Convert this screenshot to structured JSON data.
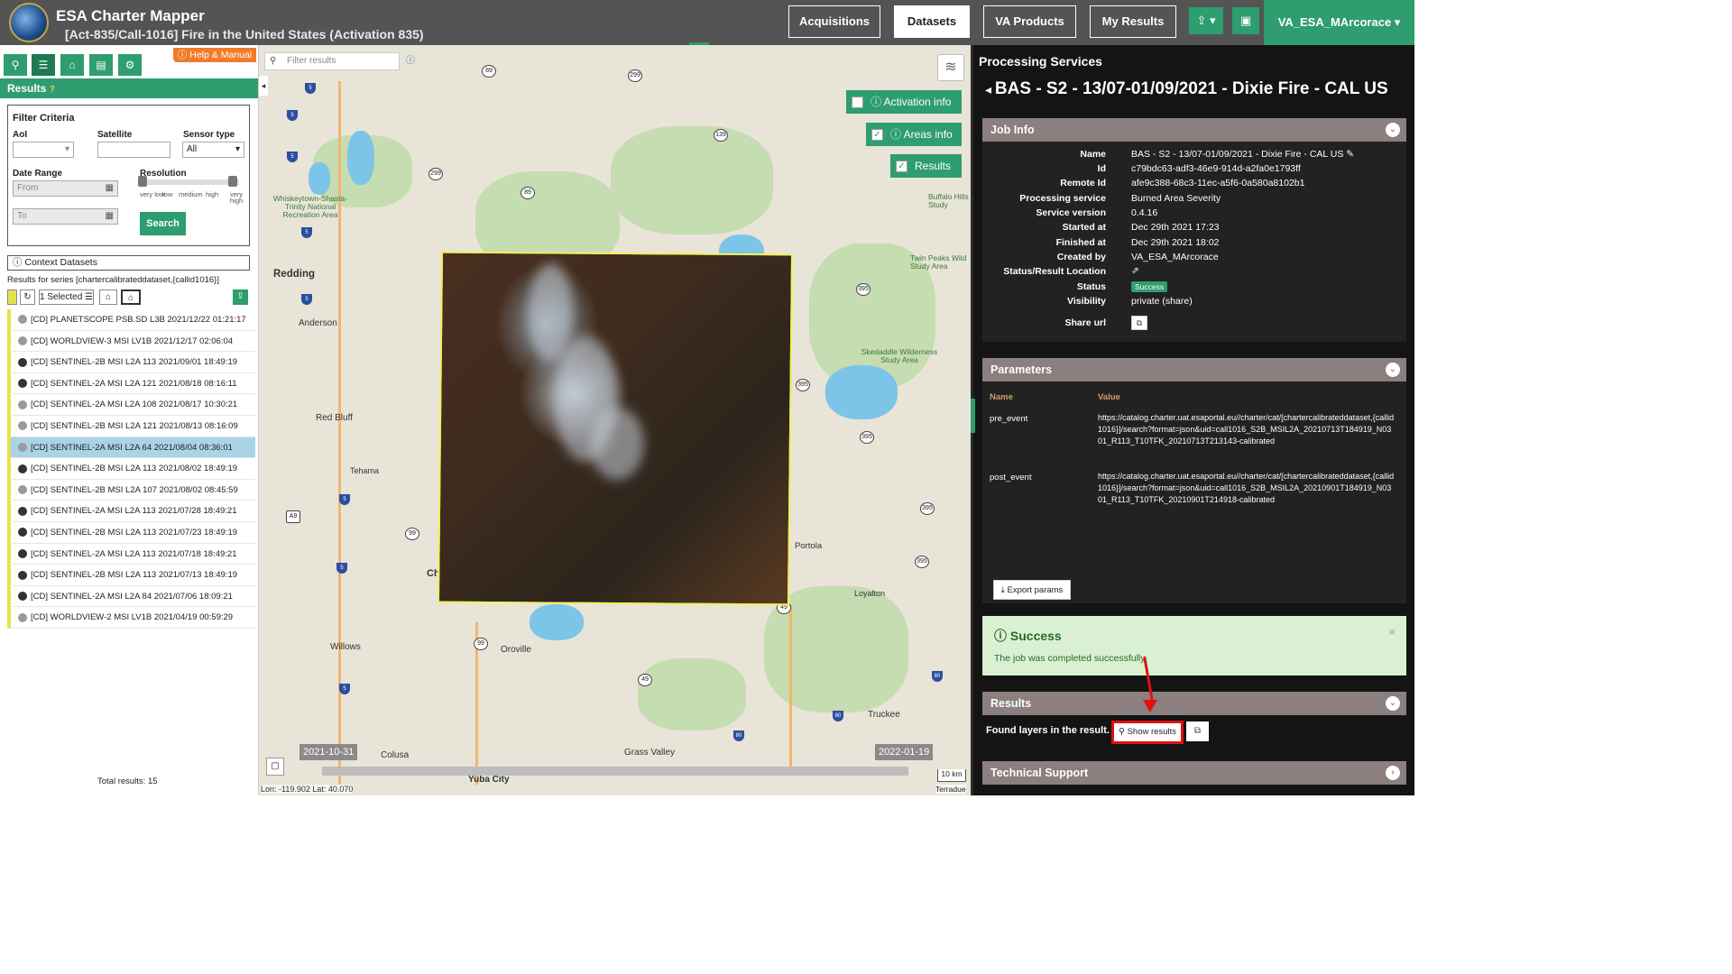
{
  "header": {
    "app_title": "ESA Charter Mapper",
    "activation_title": "[Act-835/Call-1016] Fire in the United States (Activation 835)",
    "nav": [
      "Acquisitions",
      "Datasets",
      "VA Products",
      "My Results"
    ],
    "upload_label": "⇪ ▾",
    "briefcase_label": "▣",
    "user": "VA_ESA_MArcorace ▾"
  },
  "left": {
    "help": "ⓘ Help & Manual",
    "results_label": "Results",
    "filter": {
      "title": "Filter Criteria",
      "aoi_label": "AoI",
      "satellite_label": "Satellite",
      "sensor_label": "Sensor type",
      "sensor_value": "All",
      "date_label": "Date Range",
      "from_placeholder": "From",
      "to_placeholder": "To",
      "resolution_label": "Resolution",
      "res_levels": [
        "very low",
        "low",
        "medium",
        "high",
        "very high"
      ],
      "search_label": "Search"
    },
    "context_label": "Context Datasets",
    "series_text": "Results for series [chartercalibrateddataset,{callid1016}]",
    "selected_label": "1 Selected ☰",
    "items": [
      "[CD] PLANETSCOPE PSB.SD L3B 2021/12/22 01:21:17",
      "[CD] WORLDVIEW-3 MSI LV1B 2021/12/17 02:06:04",
      "[CD] SENTINEL-2B MSI L2A 113 2021/09/01 18:49:19",
      "[CD] SENTINEL-2A MSI L2A 121 2021/08/18 08:16:11",
      "[CD] SENTINEL-2A MSI L2A 108 2021/08/17 10:30:21",
      "[CD] SENTINEL-2B MSI L2A 121 2021/08/13 08:16:09",
      "[CD] SENTINEL-2A MSI L2A 64 2021/08/04 08:36:01",
      "[CD] SENTINEL-2B MSI L2A 113 2021/08/02 18:49:19",
      "[CD] SENTINEL-2B MSI L2A 107 2021/08/02 08:45:59",
      "[CD] SENTINEL-2A MSI L2A 113 2021/07/28 18:49:21",
      "[CD] SENTINEL-2B MSI L2A 113 2021/07/23 18:49:19",
      "[CD] SENTINEL-2A MSI L2A 113 2021/07/18 18:49:21",
      "[CD] SENTINEL-2B MSI L2A 113 2021/07/13 18:49:19",
      "[CD] SENTINEL-2A MSI L2A 84 2021/07/06 18:09:21",
      "[CD] WORLDVIEW-2 MSI LV1B 2021/04/19 00:59:29"
    ],
    "selected_index": 6,
    "total": "Total results: 15"
  },
  "map": {
    "filter_placeholder": "Filter results",
    "activation_info": "ⓘ Activation info",
    "areas_info": "ⓘ Areas info",
    "results": "Results",
    "date_start": "2021-10-31",
    "date_end": "2022-01-19",
    "coords": "Lon: -119.902 Lat: 40.070",
    "scale": "10 km",
    "attribution": "Terradue",
    "places": [
      "Redding",
      "Anderson",
      "Red Bluff",
      "Tehama",
      "Willows",
      "Oroville",
      "Colusa",
      "Grass Valley",
      "Yuba City",
      "Truckee",
      "Loyalton",
      "Portola",
      "Ch",
      "Whiskeytown-Shasta-Trinity National Recreation Area",
      "Skedaddle Wilderness Study Area",
      "Twin Peaks Wild Study Area",
      "Buffalo Hills Study"
    ]
  },
  "right": {
    "section": "Processing Services",
    "job_title": "BAS - S2 - 13/07-01/09/2021 - Dixie Fire - CAL US",
    "job_info": {
      "header": "Job Info",
      "name_k": "Name",
      "name_v": "BAS - S2 - 13/07-01/09/2021 - Dixie Fire - CAL US ✎",
      "id_k": "Id",
      "id_v": "c79bdc63-adf3-46e9-914d-a2fa0e1793ff",
      "remote_k": "Remote Id",
      "remote_v": "afe9c388-68c3-11ec-a5f6-0a580a8102b1",
      "service_k": "Processing service",
      "service_v": "Burned Area Severity",
      "version_k": "Service version",
      "version_v": "0.4.16",
      "started_k": "Started at",
      "started_v": "Dec 29th 2021 17:23",
      "finished_k": "Finished at",
      "finished_v": "Dec 29th 2021 18:02",
      "created_k": "Created by",
      "created_v": "VA_ESA_MArcorace",
      "location_k": "Status/Result Location",
      "status_k": "Status",
      "status_v": "Success",
      "visibility_k": "Visibility",
      "visibility_v": "private (share)",
      "share_k": "Share url"
    },
    "parameters": {
      "header": "Parameters",
      "col_name": "Name",
      "col_value": "Value",
      "pre_k": "pre_event",
      "pre_v": "https://catalog.charter.uat.esaportal.eu//charter/cat/[chartercalibrateddataset,{callid1016}]/search?format=json&uid=call1016_S2B_MSIL2A_20210713T184919_N0301_R113_T10TFK_20210713T213143-calibrated",
      "post_k": "post_event",
      "post_v": "https://catalog.charter.uat.esaportal.eu//charter/cat/[chartercalibrateddataset,{callid1016}]/search?format=json&uid=call1016_S2B_MSIL2A_20210901T184919_N0301_R113_T10TFK_20210901T214918-calibrated",
      "export": "⤓ Export params"
    },
    "success": {
      "title": "ⓘ Success",
      "message": "The job was completed successfully.",
      "close": "×"
    },
    "results": {
      "header": "Results",
      "found": "Found layers in the result.",
      "show": "⚲ Show results"
    },
    "support": {
      "header": "Technical Support"
    }
  }
}
